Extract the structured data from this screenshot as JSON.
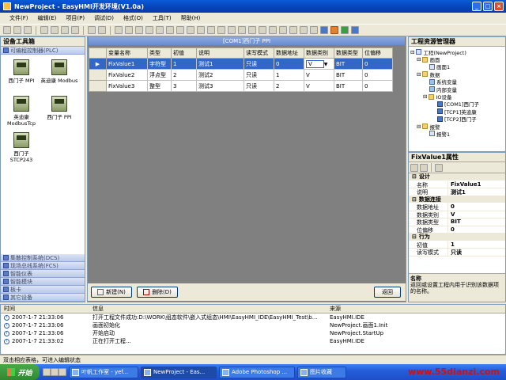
{
  "window": {
    "title": "NewProject - EasyHMI开发环境(V1.0a)",
    "buttons": [
      "_",
      "□",
      "×"
    ]
  },
  "menu": [
    "文件(F)",
    "编辑(E)",
    "项目(P)",
    "调试(D)",
    "格式(O)",
    "工具(T)",
    "帮助(H)"
  ],
  "left": {
    "title": "设备工具箱",
    "top_category": "可编程控制器(PLC)",
    "devices": [
      "西门子 MPI",
      "英迪康 Modbus",
      "英迪康 ModbusTcp",
      "西门子 PPI",
      "西门子 STCP243"
    ],
    "bottom_categories": [
      "集散控制系统(DCS)",
      "现场总线系统(FCS)",
      "智能仪表",
      "智能模块",
      "板卡",
      "其它设备"
    ]
  },
  "grid": {
    "title": "[COM1]西门子 PPI",
    "columns": [
      "变量名称",
      "类型",
      "初值",
      "说明",
      "读写模式",
      "数据地址",
      "数据类别",
      "数据类型",
      "位偏移"
    ],
    "rows": [
      {
        "indicator": "▶",
        "cells": [
          "FixValue1",
          "字符型",
          "1",
          "测试1",
          "只读",
          "0",
          "V",
          "BIT",
          "0"
        ]
      },
      {
        "indicator": "",
        "cells": [
          "FixValue2",
          "浮点型",
          "2",
          "测试2",
          "只读",
          "1",
          "V",
          "BIT",
          "0"
        ]
      },
      {
        "indicator": "",
        "cells": [
          "FixValue3",
          "整型",
          "3",
          "测试3",
          "只读",
          "2",
          "V",
          "BIT",
          "0"
        ]
      }
    ],
    "new_button": "新建(N)",
    "delete_button": "删除(D)",
    "back_button": "返回"
  },
  "explorer": {
    "title": "工程资源管理器",
    "tree": [
      "工程(NewProject)",
      "画面",
      "画面1",
      "数据",
      "系统变量",
      "内部变量",
      "IO设备",
      "[COM1]西门子",
      "[TCP1]英迪康",
      "[TCP2]西门子",
      "报警",
      "报警1"
    ]
  },
  "properties": {
    "title": "FixValue1属性",
    "categories": [
      {
        "name": "设计",
        "rows": [
          [
            "名称",
            "FixValue1"
          ],
          [
            "说明",
            "测试1"
          ]
        ]
      },
      {
        "name": "数据连接",
        "rows": [
          [
            "数据地址",
            "0"
          ],
          [
            "数据类别",
            "V"
          ],
          [
            "数据类型",
            "BIT"
          ],
          [
            "位偏移",
            "0"
          ]
        ]
      },
      {
        "name": "行为",
        "rows": [
          [
            "初值",
            "1"
          ],
          [
            "读写模式",
            "只读"
          ]
        ]
      }
    ],
    "desc_title": "名称",
    "desc_text": "返回或设置工程内用于识别该数据项的名称。"
  },
  "log": {
    "headers": [
      "时间",
      "信息",
      "来源"
    ],
    "rows": [
      [
        "2007-1-7 21:33:06",
        "打开工程文件成功:D:\\WORK\\组态软件\\嵌入式组态\\HMI\\EasyHMI_IDE\\EasyHMI_Test\\b...",
        "EasyHMI.IDE"
      ],
      [
        "2007-1-7 21:33:06",
        "画面初始化",
        "NewProject.画面1.Init"
      ],
      [
        "2007-1-7 21:33:06",
        "开始启动",
        "NewProject.StartUp"
      ],
      [
        "2007-1-7 21:33:02",
        "正在打开工程...",
        "EasyHMI.IDE"
      ]
    ]
  },
  "status": "双击相应表格，可进入编辑状态",
  "taskbar": {
    "start": "开始",
    "tasks": [
      "叶帆工作室 - yef...",
      "NewProject - Eas...",
      "Adobe Photoshop ...",
      "图片收藏"
    ]
  },
  "watermark": "www.55dianzi.com"
}
